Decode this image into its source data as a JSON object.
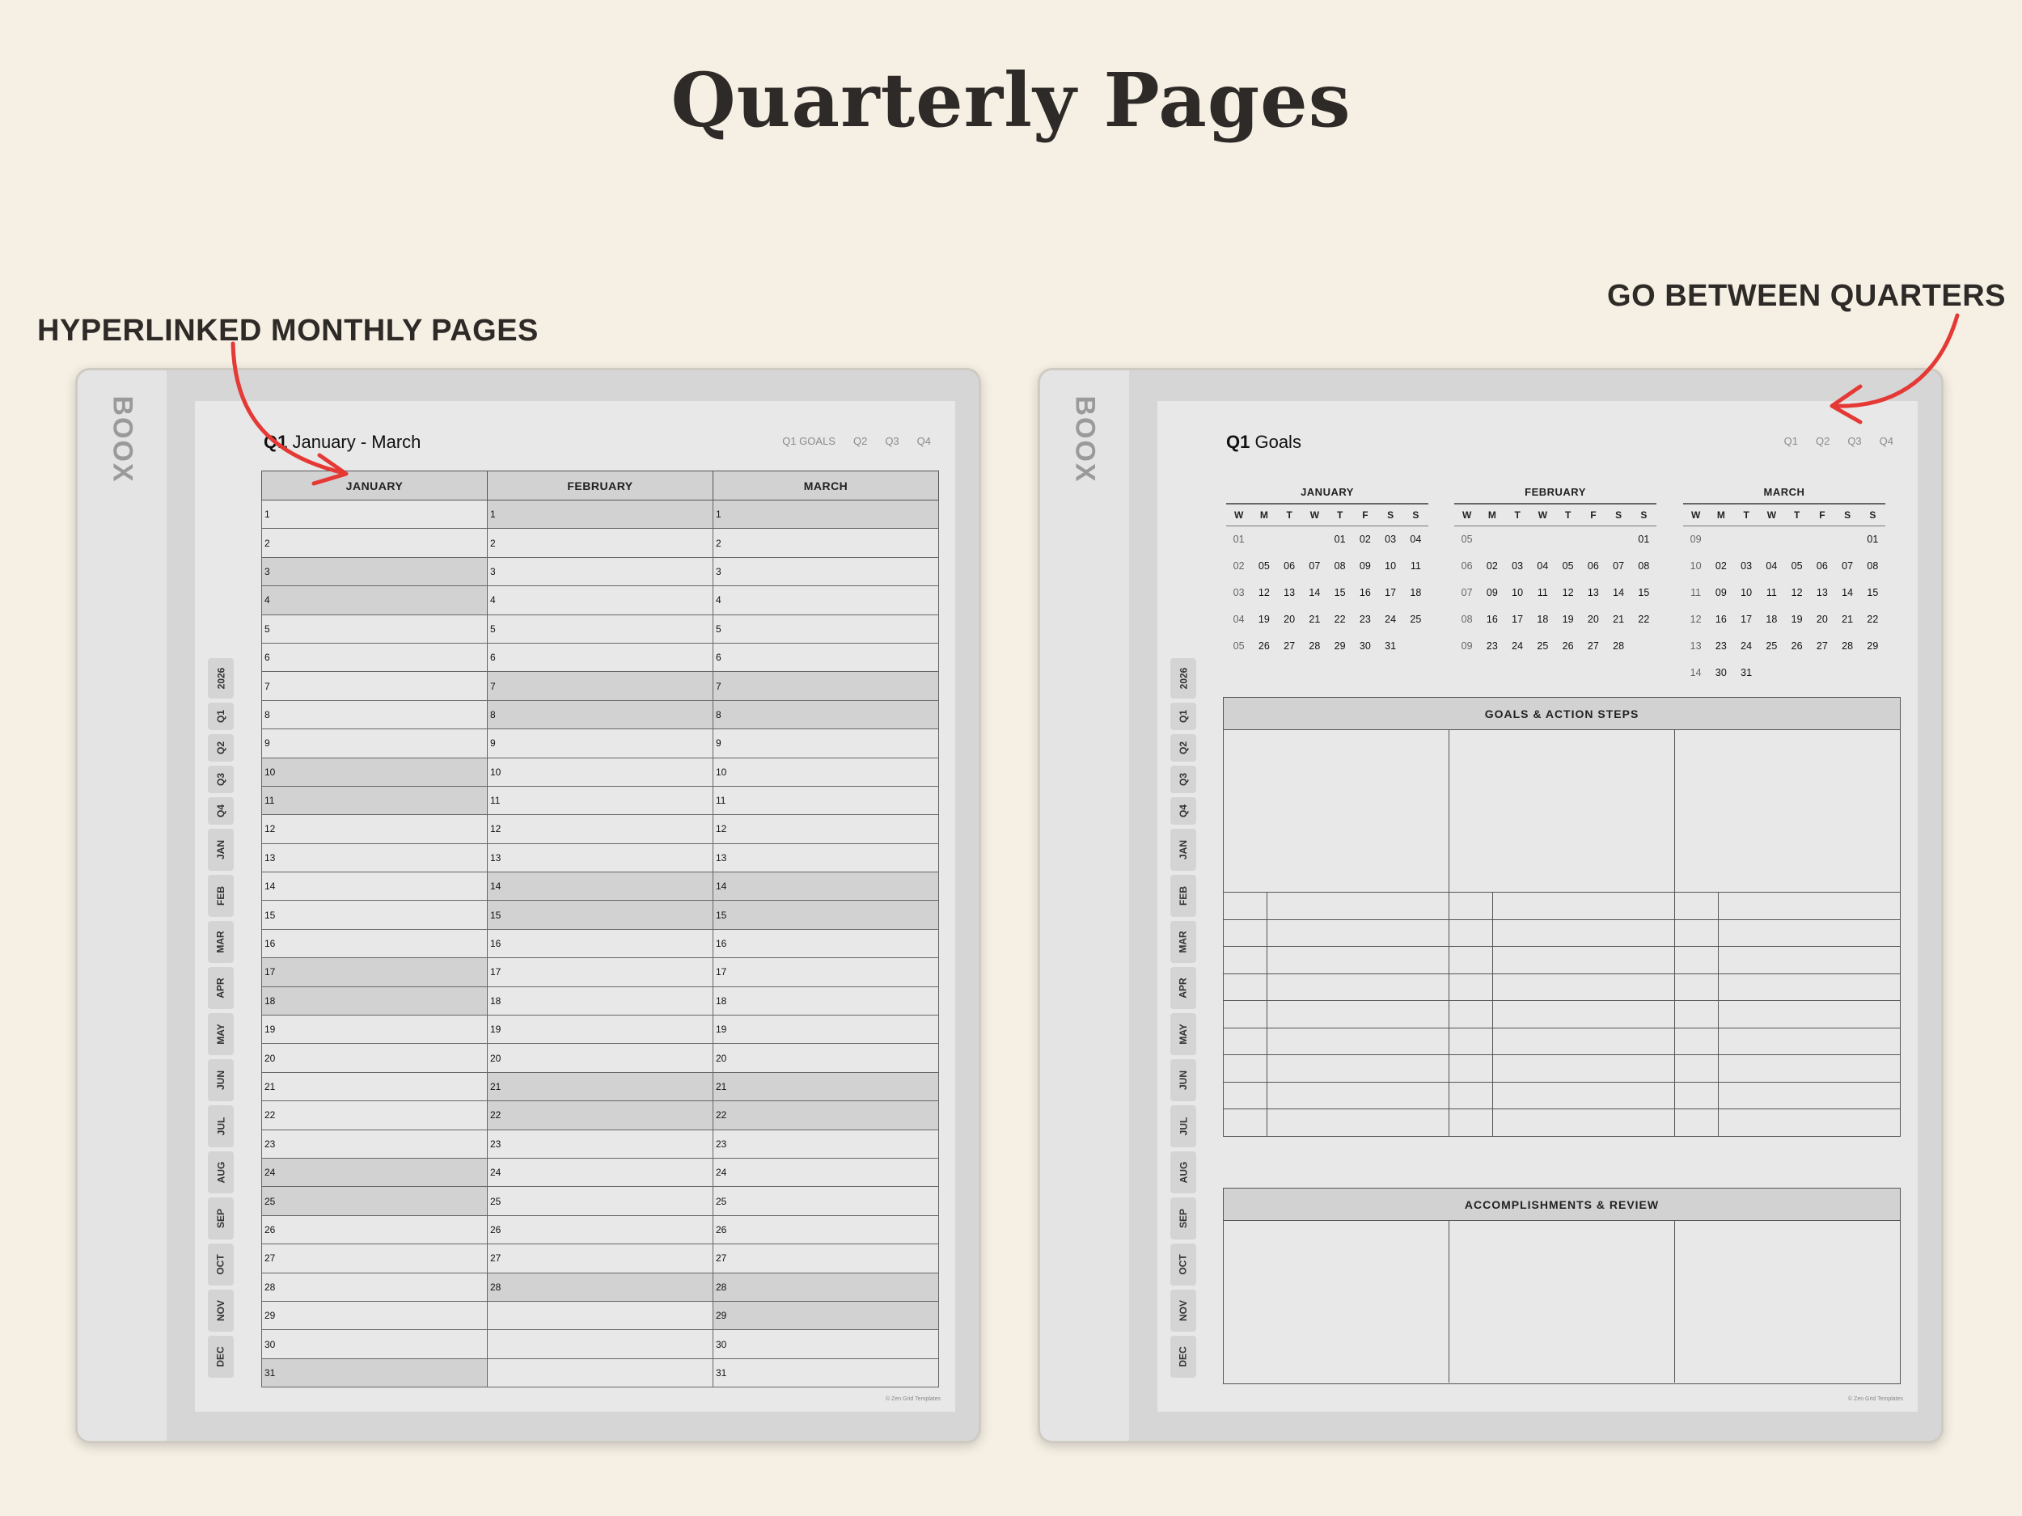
{
  "title": "Quarterly Pages",
  "annotations": {
    "left": "HYPERLINKED MONTHLY PAGES",
    "right": "GO BETWEEN QUARTERS"
  },
  "device_brand": "BOOX",
  "side_tabs": [
    "2026",
    "Q1",
    "Q2",
    "Q3",
    "Q4",
    "JAN",
    "FEB",
    "MAR",
    "APR",
    "MAY",
    "JUN",
    "JUL",
    "AUG",
    "SEP",
    "OCT",
    "NOV",
    "DEC"
  ],
  "left_page": {
    "title_bold": "Q1",
    "title_rest": " January - March",
    "nav": [
      "Q1 GOALS",
      "Q2",
      "Q3",
      "Q4"
    ],
    "months": [
      "JANUARY",
      "FEBRUARY",
      "MARCH"
    ],
    "month_days": [
      31,
      28,
      31
    ],
    "weekend_days": [
      [
        3,
        4,
        10,
        11,
        17,
        18,
        24,
        25,
        31
      ],
      [
        1,
        7,
        8,
        14,
        15,
        21,
        22,
        28
      ],
      [
        1,
        7,
        8,
        14,
        15,
        21,
        22,
        28,
        29
      ]
    ],
    "copyright": "© Zen Grid Templates"
  },
  "right_page": {
    "title_bold": "Q1",
    "title_rest": " Goals",
    "nav": [
      "Q1",
      "Q2",
      "Q3",
      "Q4"
    ],
    "weekday_headers": [
      "W",
      "M",
      "T",
      "W",
      "T",
      "F",
      "S",
      "S"
    ],
    "calendars": [
      {
        "name": "JANUARY",
        "weeks": [
          [
            "01",
            "",
            "",
            "",
            "01",
            "02",
            "03",
            "04"
          ],
          [
            "02",
            "05",
            "06",
            "07",
            "08",
            "09",
            "10",
            "11"
          ],
          [
            "03",
            "12",
            "13",
            "14",
            "15",
            "16",
            "17",
            "18"
          ],
          [
            "04",
            "19",
            "20",
            "21",
            "22",
            "23",
            "24",
            "25"
          ],
          [
            "05",
            "26",
            "27",
            "28",
            "29",
            "30",
            "31",
            ""
          ]
        ]
      },
      {
        "name": "FEBRUARY",
        "weeks": [
          [
            "05",
            "",
            "",
            "",
            "",
            "",
            "",
            "01"
          ],
          [
            "06",
            "02",
            "03",
            "04",
            "05",
            "06",
            "07",
            "08"
          ],
          [
            "07",
            "09",
            "10",
            "11",
            "12",
            "13",
            "14",
            "15"
          ],
          [
            "08",
            "16",
            "17",
            "18",
            "19",
            "20",
            "21",
            "22"
          ],
          [
            "09",
            "23",
            "24",
            "25",
            "26",
            "27",
            "28",
            ""
          ]
        ]
      },
      {
        "name": "MARCH",
        "weeks": [
          [
            "09",
            "",
            "",
            "",
            "",
            "",
            "",
            "01"
          ],
          [
            "10",
            "02",
            "03",
            "04",
            "05",
            "06",
            "07",
            "08"
          ],
          [
            "11",
            "09",
            "10",
            "11",
            "12",
            "13",
            "14",
            "15"
          ],
          [
            "12",
            "16",
            "17",
            "18",
            "19",
            "20",
            "21",
            "22"
          ],
          [
            "13",
            "23",
            "24",
            "25",
            "26",
            "27",
            "28",
            "29"
          ],
          [
            "14",
            "30",
            "31",
            "",
            "",
            "",
            "",
            ""
          ]
        ]
      }
    ],
    "goals_heading": "GOALS & ACTION STEPS",
    "goals_action_rows": 9,
    "review_heading": "ACCOMPLISHMENTS & REVIEW",
    "copyright": "© Zen Grid Templates"
  },
  "colors": {
    "background": "#f6f0e4",
    "accent_arrow": "#e53935",
    "header_fill": "#d2d2d2"
  }
}
